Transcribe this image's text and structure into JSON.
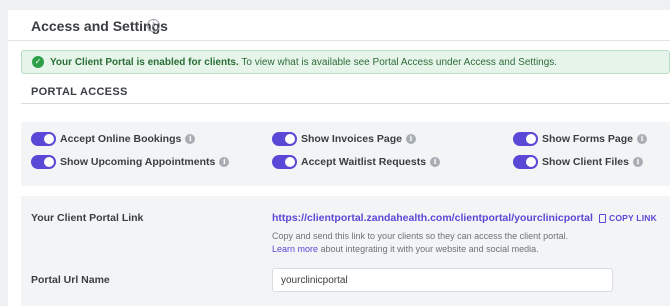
{
  "header": {
    "title": "Access and Settings",
    "info_icon": "info-icon"
  },
  "banner": {
    "strong": "Your Client Portal is enabled for clients.",
    "text": " To view what is available see Portal Access under Access and Settings.",
    "icon": "check-circle-icon",
    "color": "#2e9f49"
  },
  "section": {
    "title": "PORTAL ACCESS"
  },
  "toggles": [
    {
      "label": "Accept Online Bookings",
      "on": true
    },
    {
      "label": "Show Upcoming Appointments",
      "on": true
    },
    {
      "label": "Show Invoices Page",
      "on": true
    },
    {
      "label": "Accept Waitlist Requests",
      "on": true
    },
    {
      "label": "Show Forms Page",
      "on": true
    },
    {
      "label": "Show Client Files",
      "on": true
    }
  ],
  "link": {
    "label": "Your Client Portal Link",
    "url": "https://clientportal.zandahealth.com/clientportal/yourclinicportal",
    "copy_label": "COPY LINK",
    "help_line1": "Copy and send this link to your clients so they can access the client portal.",
    "help_link": "Learn more",
    "help_line2": " about integrating it with your website and social media."
  },
  "url_name": {
    "label": "Portal Url Name",
    "value": "yourclinicportal"
  },
  "colors": {
    "accent": "#5a48d6",
    "success": "#2e9f49"
  }
}
